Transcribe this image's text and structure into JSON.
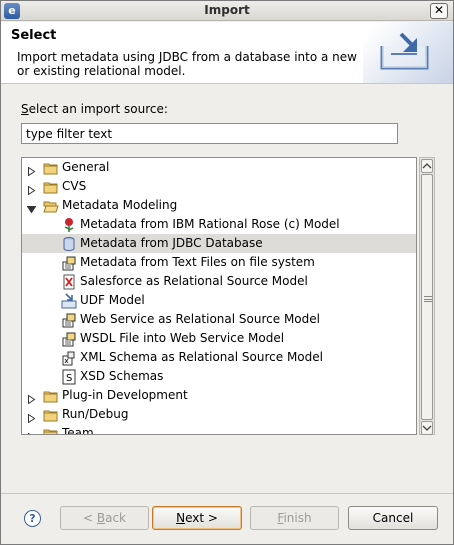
{
  "window": {
    "title": "Import"
  },
  "banner": {
    "title": "Select",
    "description": "Import metadata using JDBC from a database into a new or existing relational model."
  },
  "source_label": {
    "prefix": "",
    "accel": "S",
    "rest": "elect an import source:"
  },
  "filter": {
    "value": "type filter text",
    "placeholder": "type filter text"
  },
  "tree": {
    "selected_item": "Metadata from JDBC Database",
    "items": [
      {
        "label": "General",
        "icon": "folder-icon",
        "expanded": false,
        "level": 0
      },
      {
        "label": "CVS",
        "icon": "folder-icon",
        "expanded": false,
        "level": 0
      },
      {
        "label": "Metadata Modeling",
        "icon": "folder-open-icon",
        "expanded": true,
        "level": 0
      },
      {
        "label": "Metadata from IBM Rational Rose (c) Model",
        "icon": "rose-icon",
        "level": 1
      },
      {
        "label": "Metadata from JDBC Database",
        "icon": "database-icon",
        "level": 1
      },
      {
        "label": "Metadata from Text Files on file system",
        "icon": "import-wizard-icon",
        "level": 1
      },
      {
        "label": "Salesforce as Relational Source Model",
        "icon": "salesforce-x-icon",
        "level": 1
      },
      {
        "label": "UDF Model",
        "icon": "udf-import-icon",
        "level": 1
      },
      {
        "label": "Web Service as Relational Source Model",
        "icon": "import-wizard-icon",
        "level": 1
      },
      {
        "label": "WSDL File into Web Service Model",
        "icon": "import-wizard-icon",
        "level": 1
      },
      {
        "label": "XML Schema as Relational Source Model",
        "icon": "xml-schema-icon",
        "level": 1
      },
      {
        "label": "XSD Schemas",
        "icon": "xsd-s-icon",
        "level": 1
      },
      {
        "label": "Plug-in Development",
        "icon": "folder-icon",
        "expanded": false,
        "level": 0
      },
      {
        "label": "Run/Debug",
        "icon": "folder-icon",
        "expanded": false,
        "level": 0
      },
      {
        "label": "Team",
        "icon": "folder-icon",
        "expanded": false,
        "level": 0
      }
    ]
  },
  "buttons": {
    "help": "?",
    "back": {
      "text": "Back",
      "prefix": "< ",
      "accel": "B",
      "rest": "ack"
    },
    "next": {
      "text": "Next >",
      "accel": "N",
      "rest": "ext >"
    },
    "finish": {
      "accel": "F",
      "rest": "inish"
    },
    "cancel": "Cancel"
  }
}
